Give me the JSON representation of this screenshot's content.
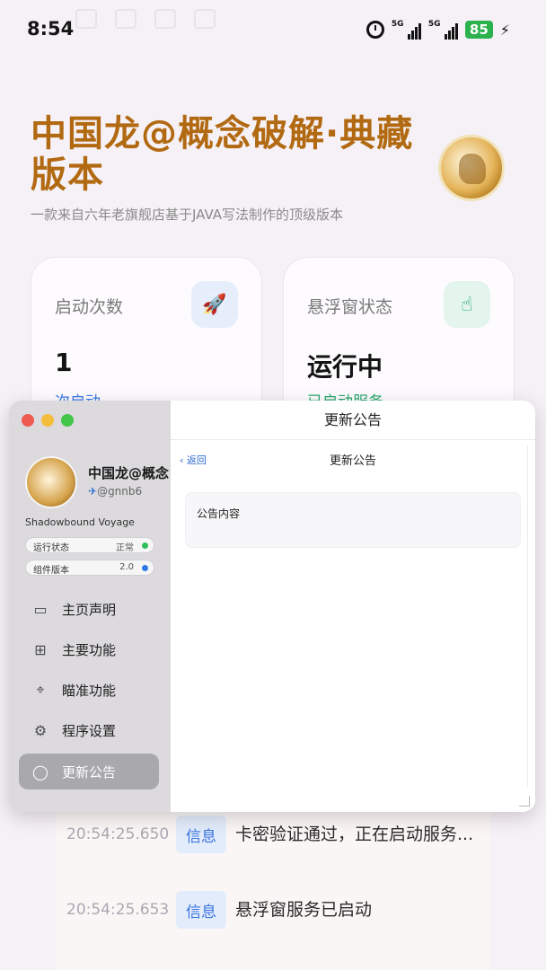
{
  "status_bar": {
    "time": "8:54",
    "signal1_tag": "5G",
    "signal2_tag": "5G",
    "battery": "85"
  },
  "header": {
    "title": "中国龙@概念破解·典藏版本",
    "subtitle": "一款来自六年老旗舰店基于JAVA写法制作的顶级版本"
  },
  "cards": [
    {
      "label": "启动次数",
      "value": "1",
      "footer": "次启动",
      "icon": "rocket-icon"
    },
    {
      "label": "悬浮窗状态",
      "value": "运行中",
      "footer": "已启动服务",
      "icon": "hand-tap-icon"
    }
  ],
  "logs": [
    {
      "time": "20:54:25.650",
      "level": "信息",
      "message": "卡密验证通过，正在启动服务..."
    },
    {
      "time": "20:54:25.653",
      "level": "信息",
      "message": "悬浮窗服务已启动"
    }
  ],
  "overlay": {
    "window_title": "更新公告",
    "profile": {
      "name": "中国龙@概念",
      "handle": "@gnnb6",
      "tagline": "Shadowbound Voyage"
    },
    "status_pills": [
      {
        "label": "运行状态",
        "value": "正常",
        "color": "#2fbf5a"
      },
      {
        "label": "组件版本",
        "value": "2.0",
        "color": "#2e7be6"
      }
    ],
    "nav": [
      {
        "label": "主页声明",
        "icon": "document-icon"
      },
      {
        "label": "主要功能",
        "icon": "grid-icon"
      },
      {
        "label": "瞄准功能",
        "icon": "crosshair-icon"
      },
      {
        "label": "程序设置",
        "icon": "gear-icon"
      },
      {
        "label": "更新公告",
        "icon": "chat-bubble-icon",
        "active": true
      }
    ],
    "page": {
      "back_label": "返回",
      "title": "更新公告",
      "notice_label": "公告内容"
    }
  },
  "colors": {
    "title_gold": "#b26a12",
    "accent_blue": "#3a78e8",
    "accent_green": "#2aa66e"
  }
}
